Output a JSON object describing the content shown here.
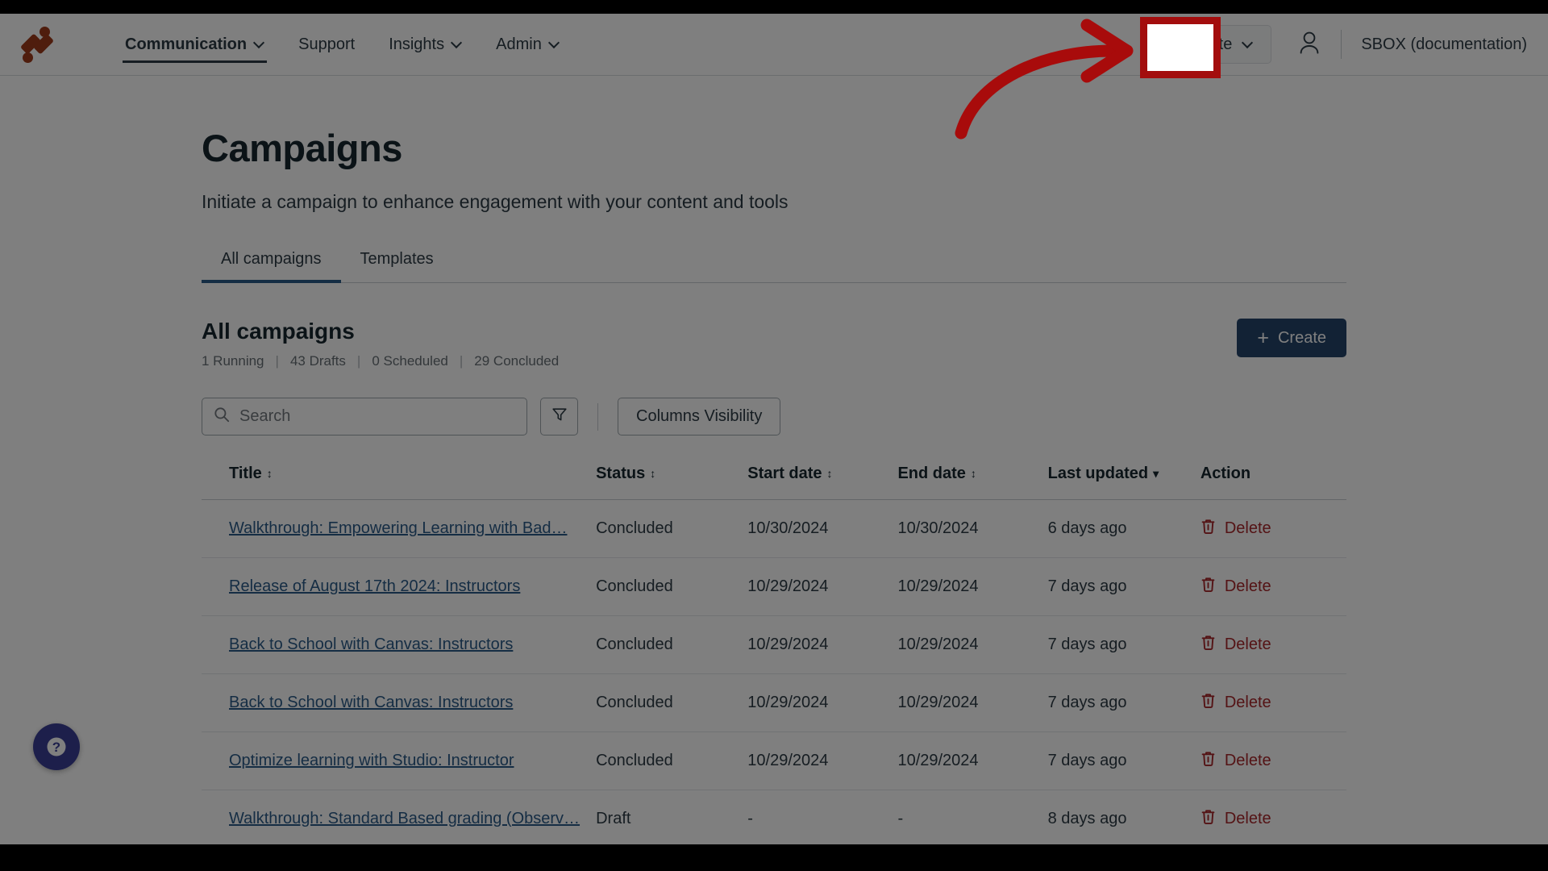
{
  "topnav": {
    "logo_name": "instructure-logo",
    "items": [
      {
        "label": "Communication",
        "has_dropdown": true,
        "active": true
      },
      {
        "label": "Support",
        "has_dropdown": false,
        "active": false
      },
      {
        "label": "Insights",
        "has_dropdown": true,
        "active": false
      },
      {
        "label": "Admin",
        "has_dropdown": true,
        "active": false
      }
    ],
    "create_label": "Create",
    "create_plus": "+",
    "org_name": "SBOX (documentation)"
  },
  "page": {
    "title": "Campaigns",
    "subtitle": "Initiate a campaign to enhance engagement with your content and tools"
  },
  "tabs": [
    {
      "label": "All campaigns",
      "active": true
    },
    {
      "label": "Templates",
      "active": false
    }
  ],
  "section": {
    "title": "All campaigns",
    "counts": [
      {
        "value": "1 Running"
      },
      {
        "value": "43 Drafts"
      },
      {
        "value": "0 Scheduled"
      },
      {
        "value": "29 Concluded"
      }
    ],
    "separator": "|",
    "create_label": "Create",
    "create_plus": "+"
  },
  "toolbar": {
    "search_placeholder": "Search",
    "search_value": "",
    "filter_icon": "filter-funnel-icon",
    "columns_visibility_label": "Columns Visibility"
  },
  "table": {
    "columns": [
      {
        "label": "Title",
        "sort": "both"
      },
      {
        "label": "Status",
        "sort": "both"
      },
      {
        "label": "Start date",
        "sort": "both"
      },
      {
        "label": "End date",
        "sort": "both"
      },
      {
        "label": "Last updated",
        "sort": "desc"
      },
      {
        "label": "Action",
        "sort": "none"
      }
    ],
    "sort_glyph_both": "↕",
    "sort_glyph_desc": "▾",
    "delete_label": "Delete",
    "rows": [
      {
        "title": "Walkthrough: Empowering Learning with Bad…",
        "status": "Concluded",
        "start_date": "10/30/2024",
        "end_date": "10/30/2024",
        "last_updated": "6 days ago"
      },
      {
        "title": "Release of August 17th 2024: Instructors",
        "status": "Concluded",
        "start_date": "10/29/2024",
        "end_date": "10/29/2024",
        "last_updated": "7 days ago"
      },
      {
        "title": "Back to School with Canvas: Instructors",
        "status": "Concluded",
        "start_date": "10/29/2024",
        "end_date": "10/29/2024",
        "last_updated": "7 days ago"
      },
      {
        "title": "Back to School with Canvas: Instructors",
        "status": "Concluded",
        "start_date": "10/29/2024",
        "end_date": "10/29/2024",
        "last_updated": "7 days ago"
      },
      {
        "title": "Optimize learning with Studio: Instructor",
        "status": "Concluded",
        "start_date": "10/29/2024",
        "end_date": "10/29/2024",
        "last_updated": "7 days ago"
      },
      {
        "title": "Walkthrough: Standard Based grading (Observ…",
        "status": "Draft",
        "start_date": "-",
        "end_date": "-",
        "last_updated": "8 days ago"
      }
    ]
  },
  "help": {
    "glyph": "?"
  },
  "annotation": {
    "highlight_color": "#a30d0d",
    "arrow_color": "#a80b0b",
    "target": "create-nav-button"
  },
  "colors": {
    "brand": "#9e3b1b",
    "accent_tab": "#2b5b88",
    "primary_button": "#24456b",
    "link": "#2b5b88",
    "danger": "#a8262a",
    "help_bubble": "#3b3f96"
  }
}
